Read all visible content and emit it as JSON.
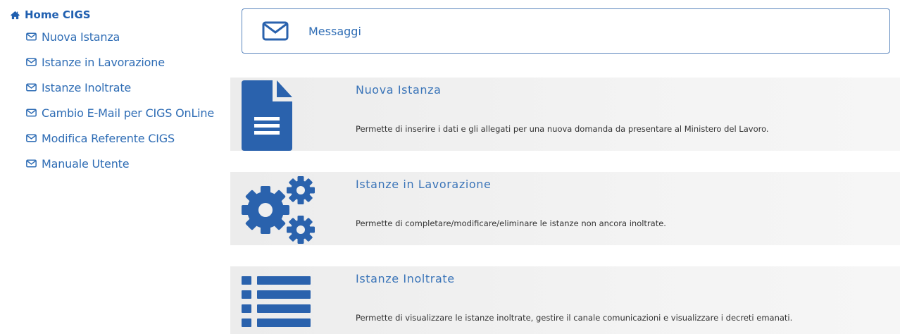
{
  "sidebar": {
    "home": {
      "label": "Home CIGS",
      "icon": "home-icon"
    },
    "items": [
      {
        "label": "Nuova Istanza",
        "icon": "envelope-icon"
      },
      {
        "label": "Istanze in Lavorazione",
        "icon": "envelope-icon"
      },
      {
        "label": "Istanze Inoltrate",
        "icon": "envelope-icon"
      },
      {
        "label": "Cambio E-Mail per CIGS OnLine",
        "icon": "envelope-icon"
      },
      {
        "label": "Modifica Referente CIGS",
        "icon": "envelope-icon"
      },
      {
        "label": "Manuale Utente",
        "icon": "envelope-icon"
      }
    ]
  },
  "messages": {
    "label": "Messaggi",
    "icon": "envelope-icon"
  },
  "cards": [
    {
      "title": "Nuova Istanza",
      "description": "Permette di inserire i dati e gli allegati per una nuova domanda da presentare al Ministero del Lavoro.",
      "icon": "document-icon"
    },
    {
      "title": "Istanze in Lavorazione",
      "description": "Permette di completare/modificare/eliminare le istanze non ancora inoltrate.",
      "icon": "gears-icon"
    },
    {
      "title": "Istanze Inoltrate",
      "description": "Permette di visualizzare le istanze inoltrate, gestire il canale comunicazioni e visualizzare i decreti emanati.",
      "icon": "list-icon"
    }
  ],
  "colors": {
    "accent": "#2f6db5",
    "icon_blue": "#2a62ad",
    "card_bg": "#efefef",
    "text": "#333333"
  }
}
